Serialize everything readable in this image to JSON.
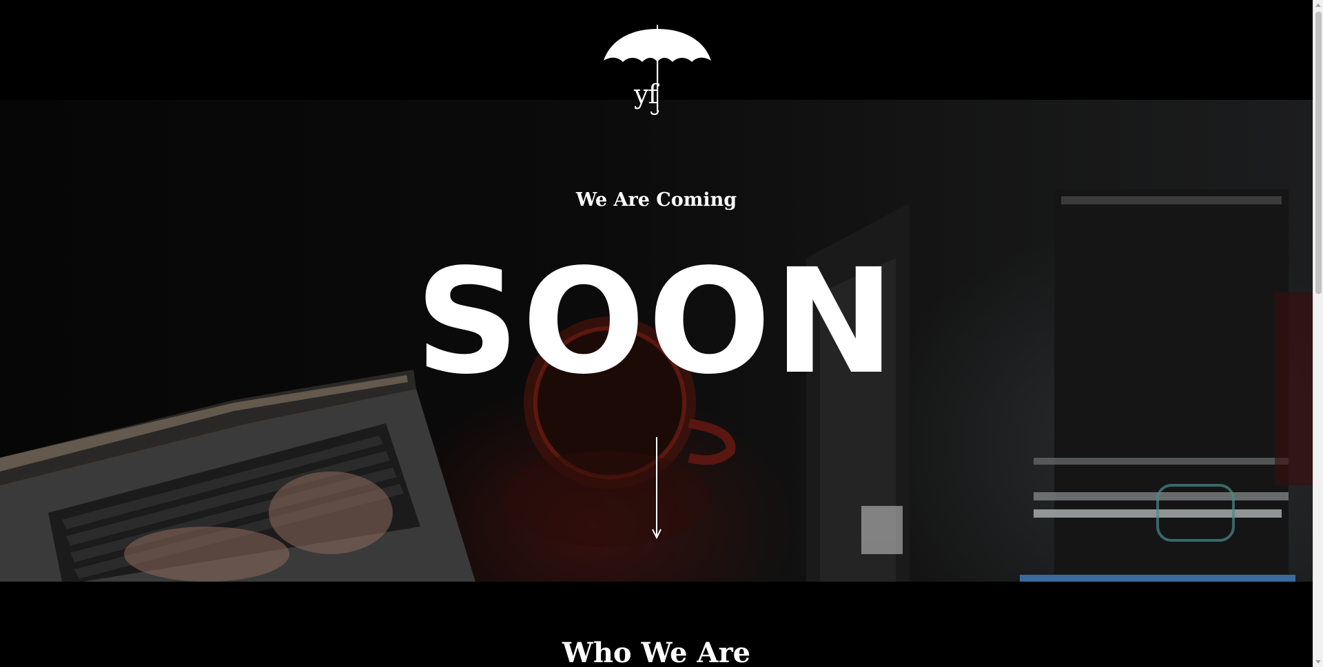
{
  "header": {
    "logo_text": "yf",
    "logo_icon": "umbrella-icon"
  },
  "hero": {
    "subtitle": "We Are Coming",
    "title": "SOON",
    "scroll_icon": "arrow-down-icon",
    "background_icon": "laptop-coffee-desk-photo"
  },
  "about": {
    "heading": "Who We Are"
  },
  "colors": {
    "background": "#000000",
    "text": "#ffffff"
  }
}
